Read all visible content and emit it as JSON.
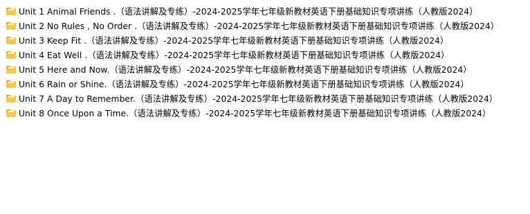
{
  "icon": {
    "name": "folder-icon",
    "color_front": "#f5c84c",
    "color_back": "#e0a82e",
    "color_paper": "#ffffff"
  },
  "folders": [
    {
      "label": "Unit 1 Animal Friends .（语法讲解及专练）-2024-2025学年七年级新教材英语下册基础知识专项讲练（人教版2024）"
    },
    {
      "label": "Unit 2 No Rules , No Order  .（语法讲解及专练）-2024-2025学年七年级新教材英语下册基础知识专项讲练（人教版2024）"
    },
    {
      "label": "Unit 3 Keep Fit  .（语法讲解及专练）-2024-2025学年七年级新教材英语下册基础知识专项讲练（人教版2024）"
    },
    {
      "label": "Unit 4 Eat Well  .（语法讲解及专练）-2024-2025学年七年级新教材英语下册基础知识专项讲练（人教版2024）"
    },
    {
      "label": "Unit 5 Here and Now.（语法讲解及专练）-2024-2025学年七年级新教材英语下册基础知识专项讲练（人教版2024）"
    },
    {
      "label": "Unit 6 Rain or Shine.（语法讲解及专练）-2024-2025学年七年级新教材英语下册基础知识专项讲练（人教版2024）"
    },
    {
      "label": "Unit 7 A Day to Remember.（语法讲解及专练）-2024-2025学年七年级新教材英语下册基础知识专项讲练（人教版2024）"
    },
    {
      "label": "Unit 8 Once Upon a Time.（语法讲解及专练）-2024-2025学年七年级新教材英语下册基础知识专项讲练（人教版2024）"
    }
  ]
}
